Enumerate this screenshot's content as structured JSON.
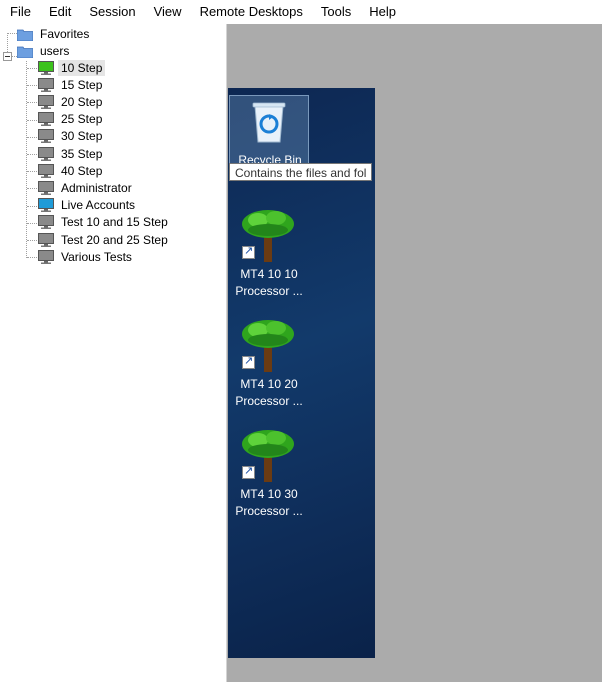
{
  "menu": [
    "File",
    "Edit",
    "Session",
    "View",
    "Remote Desktops",
    "Tools",
    "Help"
  ],
  "tree": {
    "favorites": "Favorites",
    "users": "users",
    "children": [
      {
        "label": "10 Step",
        "icon": "monitor-green-icon",
        "selected": true
      },
      {
        "label": "15 Step",
        "icon": "monitor-gray-icon"
      },
      {
        "label": "20 Step",
        "icon": "monitor-gray-icon"
      },
      {
        "label": "25 Step",
        "icon": "monitor-gray-icon"
      },
      {
        "label": "30 Step",
        "icon": "monitor-gray-icon"
      },
      {
        "label": "35 Step",
        "icon": "monitor-gray-icon"
      },
      {
        "label": "40 Step",
        "icon": "monitor-gray-icon"
      },
      {
        "label": "Administrator",
        "icon": "monitor-gray-icon"
      },
      {
        "label": "Live Accounts",
        "icon": "monitor-blue-icon"
      },
      {
        "label": "Test 10 and 15 Step",
        "icon": "monitor-gray-icon"
      },
      {
        "label": "Test 20 and 25 Step",
        "icon": "monitor-gray-icon"
      },
      {
        "label": "Various Tests",
        "icon": "monitor-gray-icon"
      }
    ]
  },
  "desktop": {
    "recycle_bin": "Recycle Bin",
    "tooltip": "Contains the files and fol",
    "icons": [
      {
        "line1": "MT4 10 10",
        "line2": "Processor ..."
      },
      {
        "line1": "MT4 10 20",
        "line2": "Processor ..."
      },
      {
        "line1": "MT4 10 30",
        "line2": "Processor ..."
      }
    ]
  },
  "colors": {
    "monitor_green": "#3cc21c",
    "monitor_gray": "#8a8a8a",
    "monitor_blue": "#1f9bd8",
    "folder_blue": "#6d9fe0",
    "viewer_gray": "#ababab",
    "desktop_bg": "#123a6b"
  }
}
